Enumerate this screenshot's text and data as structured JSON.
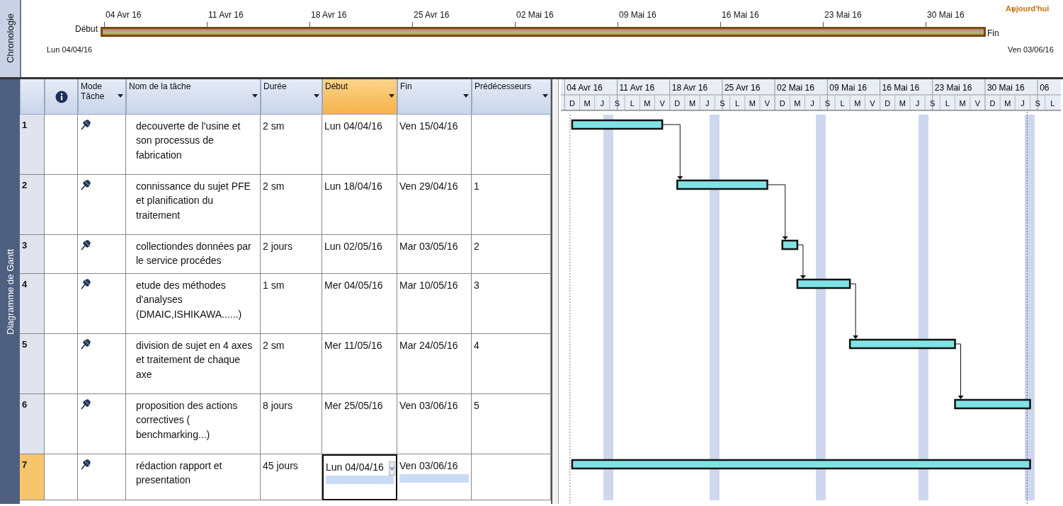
{
  "timeline": {
    "tab_label": "Chronologie",
    "ticks": [
      "04 Avr 16",
      "11 Avr 16",
      "18 Avr 16",
      "25 Avr 16",
      "02 Mai 16",
      "09 Mai 16",
      "16 Mai 16",
      "23 Mai 16",
      "30 Mai 16"
    ],
    "today_label": "Aujourd'hui",
    "start_label": "Début",
    "start_date": "Lun 04/04/16",
    "end_label": "Fin",
    "end_date": "Ven 03/06/16"
  },
  "gantt_view": {
    "tab_label": "Diagramme de Gantt",
    "columns": [
      {
        "label": "Mode Tâche",
        "selected": false
      },
      {
        "label": "Nom de la tâche",
        "selected": false
      },
      {
        "label": "Durée",
        "selected": false
      },
      {
        "label": "Début",
        "selected": true
      },
      {
        "label": "Fin",
        "selected": false
      },
      {
        "label": "Prédécesseurs",
        "selected": false
      }
    ],
    "rows": [
      {
        "id": "1",
        "name": "decouverte de l'usine et son processus de fabrication",
        "duration": "2 sm",
        "start": "Lun 04/04/16",
        "finish": "Ven 15/04/16",
        "selected": false
      },
      {
        "id": "2",
        "name": "connissance du sujet PFE et planification du traitement",
        "duration": "2 sm",
        "start": "Lun 18/04/16",
        "finish": "Ven 29/04/16",
        "predecessors": "1",
        "selected": false
      },
      {
        "id": "3",
        "name": "collectiondes données par le service procédes",
        "duration": "2 jours",
        "start": "Lun 02/05/16",
        "finish": "Mar 03/05/16",
        "predecessors": "2",
        "selected": false
      },
      {
        "id": "4",
        "name": "etude des méthodes d'analyses (DMAIC,ISHIKAWA......)",
        "duration": "1 sm",
        "start": "Mer 04/05/16",
        "finish": "Mar 10/05/16",
        "predecessors": "3",
        "selected": false
      },
      {
        "id": "5",
        "name": "division de sujet en 4 axes et traitement de chaque axe",
        "duration": "2 sm",
        "start": "Mer 11/05/16",
        "finish": "Mar 24/05/16",
        "predecessors": "4",
        "selected": false
      },
      {
        "id": "6",
        "name": "proposition des actions correctives ( benchmarking...)",
        "duration": "8 jours",
        "start": "Mer 25/05/16",
        "finish": "Ven 03/06/16",
        "predecessors": "5",
        "selected": false
      },
      {
        "id": "7",
        "name": "rédaction rapport et presentation",
        "duration": "45 jours",
        "start": "Lun 04/04/16",
        "finish": "Ven 03/06/16",
        "selected": true
      }
    ],
    "timescale": {
      "weeks": [
        "04 Avr 16",
        "11 Avr 16",
        "18 Avr 16",
        "25 Avr 16",
        "02 Mai 16",
        "09 Mai 16",
        "16 Mai 16",
        "23 Mai 16",
        "30 Mai 16",
        "06"
      ],
      "days": [
        "D",
        "M",
        "J",
        "S",
        "L",
        "M",
        "V",
        "D",
        "M",
        "J",
        "S",
        "L",
        "M",
        "V",
        "D",
        "M",
        "J",
        "S",
        "L",
        "M",
        "V",
        "D",
        "M",
        "J",
        "S",
        "L",
        "M",
        "V",
        "D",
        "M",
        "J",
        "S",
        "L"
      ]
    }
  }
}
